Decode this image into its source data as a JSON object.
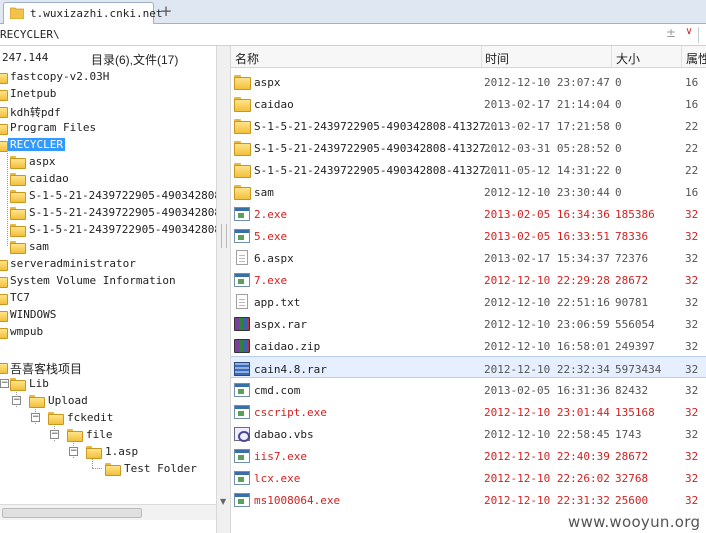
{
  "tab": {
    "label": "t.wuxizazhi.cnki.net",
    "new_tab": "+"
  },
  "address": {
    "path": "RECYCLER\\",
    "sort_icon": "±",
    "dropdown_icon": "∨"
  },
  "left_header": {
    "ip": "247.144",
    "summary": "目录(6),文件(17)"
  },
  "tree": {
    "items": [
      {
        "label": "fastcopy-v2.03H"
      },
      {
        "label": "Inetpub"
      },
      {
        "label": "kdh转pdf"
      },
      {
        "label": "Program Files"
      },
      {
        "label": "RECYCLER"
      },
      {
        "label": "aspx"
      },
      {
        "label": "caidao"
      },
      {
        "label": "S-1-5-21-2439722905-490342808-4"
      },
      {
        "label": "S-1-5-21-2439722905-490342808-4"
      },
      {
        "label": "S-1-5-21-2439722905-490342808-4"
      },
      {
        "label": "sam"
      },
      {
        "label": "serveradministrator"
      },
      {
        "label": "System Volume Information"
      },
      {
        "label": "TC7"
      },
      {
        "label": "WINDOWS"
      },
      {
        "label": "wmpub"
      }
    ],
    "bookmark": {
      "root": "吾喜客栈项目",
      "children": [
        {
          "label": "Lib"
        },
        {
          "label": "Upload"
        },
        {
          "label": "fckedit"
        },
        {
          "label": "file"
        },
        {
          "label": "1.asp"
        },
        {
          "label": "Test Folder"
        }
      ],
      "collapse_sign": "−"
    }
  },
  "columns": {
    "name": "名称",
    "time": "时间",
    "size": "大小",
    "attr": "属性"
  },
  "files": [
    {
      "name": "aspx",
      "time": "2012-12-10 23:07:47",
      "size": "0",
      "attr": "16",
      "icon": "folder-icon"
    },
    {
      "name": "caidao",
      "time": "2013-02-17 21:14:04",
      "size": "0",
      "attr": "16",
      "icon": "folder-icon"
    },
    {
      "name": "S-1-5-21-2439722905-490342808-41327...",
      "time": "2013-02-17 17:21:58",
      "size": "0",
      "attr": "22",
      "icon": "folder-icon"
    },
    {
      "name": "S-1-5-21-2439722905-490342808-41327...",
      "time": "2012-03-31 05:28:52",
      "size": "0",
      "attr": "22",
      "icon": "folder-icon"
    },
    {
      "name": "S-1-5-21-2439722905-490342808-41327...",
      "time": "2011-05-12 14:31:22",
      "size": "0",
      "attr": "22",
      "icon": "folder-icon"
    },
    {
      "name": "sam",
      "time": "2012-12-10 23:30:44",
      "size": "0",
      "attr": "16",
      "icon": "folder-icon"
    },
    {
      "name": "2.exe",
      "time": "2013-02-05 16:34:36",
      "size": "185386",
      "attr": "32",
      "icon": "exe-icon"
    },
    {
      "name": "5.exe",
      "time": "2013-02-05 16:33:51",
      "size": "78336",
      "attr": "32",
      "icon": "exe-icon"
    },
    {
      "name": "6.aspx",
      "time": "2013-02-17 15:34:37",
      "size": "72376",
      "attr": "32",
      "icon": "document-icon"
    },
    {
      "name": "7.exe",
      "time": "2012-12-10 22:29:28",
      "size": "28672",
      "attr": "32",
      "icon": "exe-icon"
    },
    {
      "name": "app.txt",
      "time": "2012-12-10 22:51:16",
      "size": "90781",
      "attr": "32",
      "icon": "document-icon"
    },
    {
      "name": "aspx.rar",
      "time": "2012-12-10 23:06:59",
      "size": "556054",
      "attr": "32",
      "icon": "rar-icon"
    },
    {
      "name": "caidao.zip",
      "time": "2012-12-10 16:58:01",
      "size": "249397",
      "attr": "32",
      "icon": "rar-icon"
    },
    {
      "name": "cain4.8.rar",
      "time": "2012-12-10 22:32:34",
      "size": "5973434",
      "attr": "32",
      "icon": "archive-icon"
    },
    {
      "name": "cmd.com",
      "time": "2013-02-05 16:31:36",
      "size": "82432",
      "attr": "32",
      "icon": "exe-icon"
    },
    {
      "name": "cscript.exe",
      "time": "2012-12-10 23:01:44",
      "size": "135168",
      "attr": "32",
      "icon": "exe-icon"
    },
    {
      "name": "dabao.vbs",
      "time": "2012-12-10 22:58:45",
      "size": "1743",
      "attr": "32",
      "icon": "script-icon"
    },
    {
      "name": "iis7.exe",
      "time": "2012-12-10 22:40:39",
      "size": "28672",
      "attr": "32",
      "icon": "exe-icon"
    },
    {
      "name": "lcx.exe",
      "time": "2012-12-10 22:26:02",
      "size": "32768",
      "attr": "32",
      "icon": "exe-icon"
    },
    {
      "name": "ms1008064.exe",
      "time": "2012-12-10 22:31:32",
      "size": "25600",
      "attr": "32",
      "icon": "exe-icon"
    }
  ],
  "watermark": "www.wooyun.org",
  "colors": {
    "exe_red": "#d42020",
    "selection_blue": "#3399ff",
    "highlight_row": "#e5efff"
  }
}
